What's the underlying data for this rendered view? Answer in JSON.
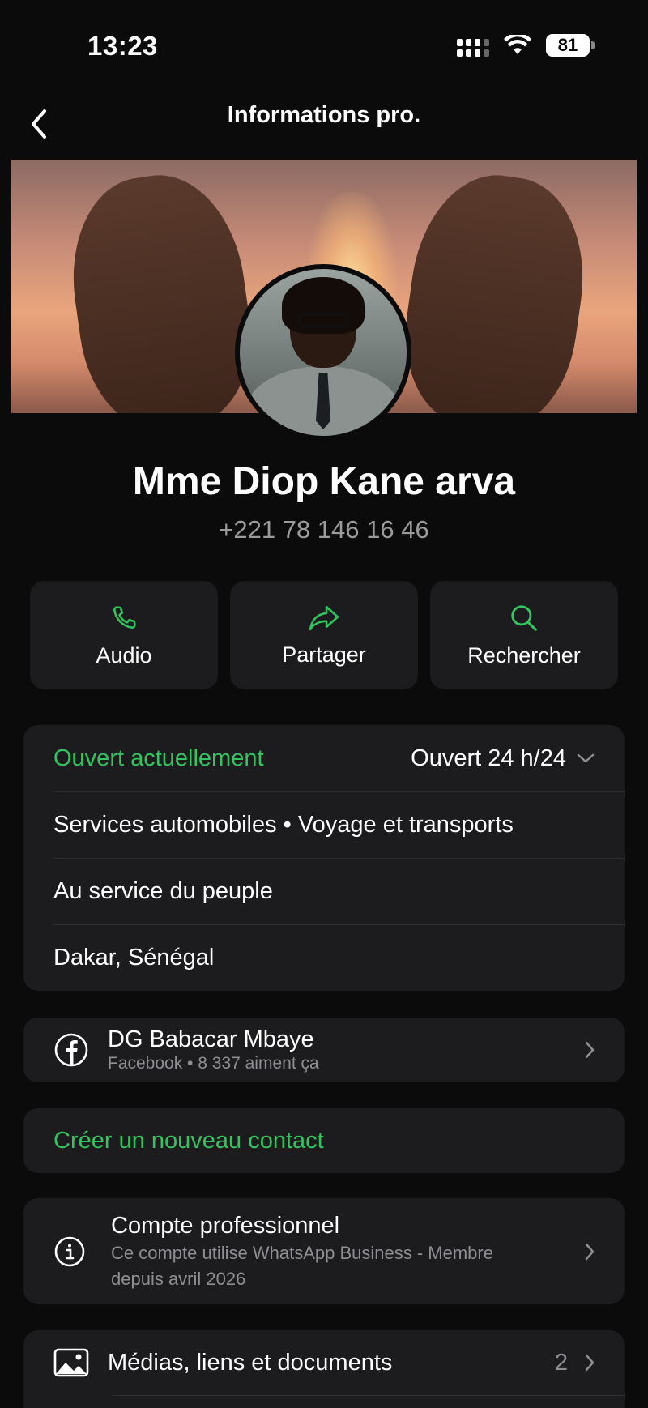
{
  "status_bar": {
    "time": "13:23",
    "battery": "81"
  },
  "header": {
    "title": "Informations pro."
  },
  "profile": {
    "name": "Mme Diop Kane arva",
    "phone": "+221 78 146 16 46"
  },
  "actions": [
    {
      "label": "Audio",
      "icon": "phone-icon"
    },
    {
      "label": "Partager",
      "icon": "share-icon"
    },
    {
      "label": "Rechercher",
      "icon": "search-icon"
    }
  ],
  "info": {
    "open_status": "Ouvert actuellement",
    "hours": "Ouvert 24 h/24",
    "categories": "Services automobiles • Voyage et transports",
    "description": "Au service du peuple",
    "location": "Dakar, Sénégal"
  },
  "facebook": {
    "title": "DG Babacar Mbaye",
    "subtitle": "Facebook • 8 337 aiment ça"
  },
  "new_contact": {
    "label": "Créer un nouveau contact"
  },
  "business": {
    "title": "Compte professionnel",
    "subtitle": "Ce compte utilise WhatsApp Business - Membre depuis avril 2026"
  },
  "media": {
    "label": "Médias, liens et documents",
    "count": "2"
  },
  "colors": {
    "accent": "#33c35f",
    "background": "#0b0b0b",
    "card": "#1c1c1e",
    "muted": "#8e8e93"
  }
}
